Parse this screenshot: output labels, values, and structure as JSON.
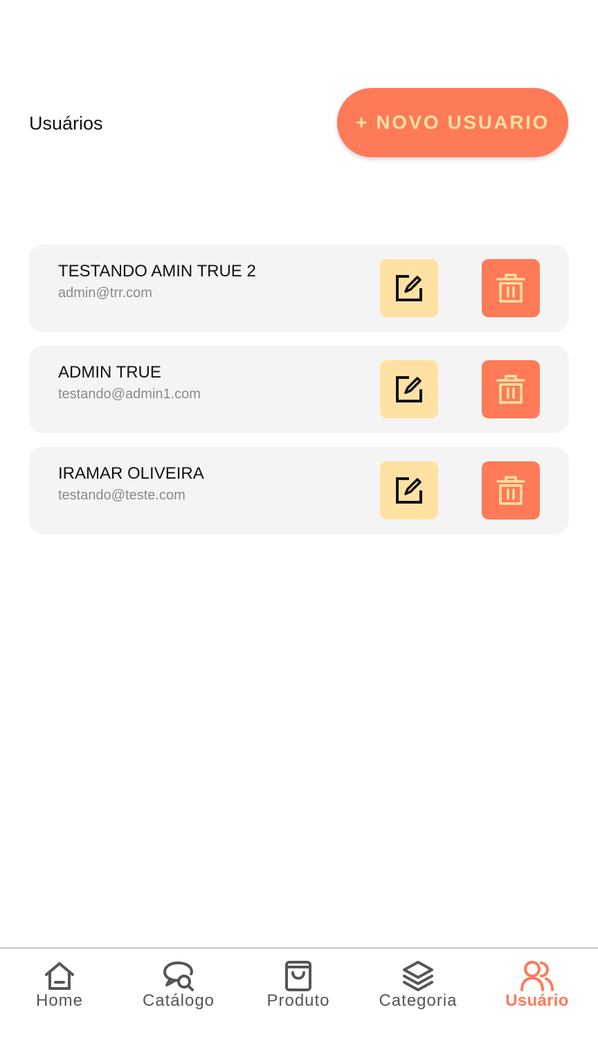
{
  "header": {
    "title": "Usuários",
    "new_user_label": "+ NOVO USUARIO"
  },
  "users": [
    {
      "name": "TESTANDO AMIN TRUE 2",
      "email": "admin@trr.com"
    },
    {
      "name": "ADMIN TRUE",
      "email": "testando@admin1.com"
    },
    {
      "name": "IRAMAR OLIVEIRA",
      "email": "testando@teste.com"
    }
  ],
  "nav": {
    "items": [
      {
        "label": "Home",
        "icon": "home-icon"
      },
      {
        "label": "Catálogo",
        "icon": "catalog-search-icon"
      },
      {
        "label": "Produto",
        "icon": "shopping-bag-icon"
      },
      {
        "label": "Categoria",
        "icon": "layers-icon"
      },
      {
        "label": "Usuário",
        "icon": "users-icon"
      }
    ],
    "active": "Usuário"
  },
  "colors": {
    "accent": "#ff7a57",
    "accent_light": "#ffe1a3",
    "card_background": "#f4f4f4",
    "nav_inactive": "#555555"
  }
}
